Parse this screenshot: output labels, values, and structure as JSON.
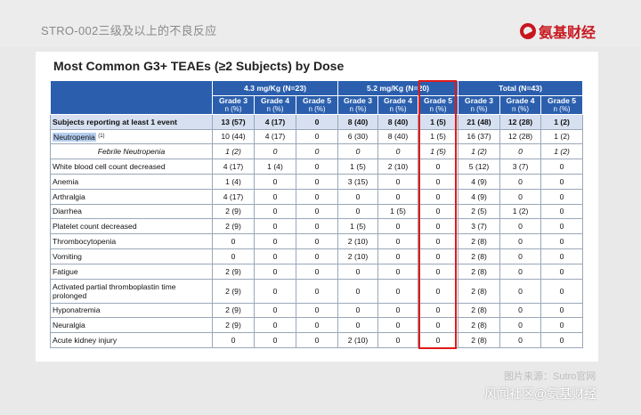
{
  "header": {
    "title": "STRO-002三级及以上的不良反应",
    "logo_text": "氨基财经"
  },
  "slide": {
    "title": "Most Common G3+ TEAEs (≥2 Subjects) by Dose"
  },
  "table": {
    "dose_groups": [
      "4.3 mg/Kg (N=23)",
      "5.2 mg/Kg (N=20)",
      "Total (N=43)"
    ],
    "grade_labels": [
      "Grade 3",
      "Grade 4",
      "Grade 5"
    ],
    "unit_label": "n (%)",
    "rows": [
      {
        "label": "Subjects reporting at least 1 event",
        "values": [
          "13 (57)",
          "4 (17)",
          "0",
          "8 (40)",
          "8 (40)",
          "1 (5)",
          "21 (48)",
          "12 (28)",
          "1 (2)"
        ]
      },
      {
        "label": "Neutropenia",
        "note": "(1)",
        "values": [
          "10 (44)",
          "4 (17)",
          "0",
          "6 (30)",
          "8 (40)",
          "1 (5)",
          "16 (37)",
          "12 (28)",
          "1 (2)"
        ]
      },
      {
        "label": "Febrile Neutropenia",
        "values": [
          "1 (2)",
          "0",
          "0",
          "0",
          "0",
          "1 (5)",
          "1 (2)",
          "0",
          "1 (2)"
        ]
      },
      {
        "label": "White blood cell count decreased",
        "values": [
          "4 (17)",
          "1 (4)",
          "0",
          "1 (5)",
          "2 (10)",
          "0",
          "5 (12)",
          "3 (7)",
          "0"
        ]
      },
      {
        "label": "Anemia",
        "values": [
          "1 (4)",
          "0",
          "0",
          "3 (15)",
          "0",
          "0",
          "4 (9)",
          "0",
          "0"
        ]
      },
      {
        "label": "Arthralgia",
        "values": [
          "4 (17)",
          "0",
          "0",
          "0",
          "0",
          "0",
          "4 (9)",
          "0",
          "0"
        ]
      },
      {
        "label": "Diarrhea",
        "values": [
          "2 (9)",
          "0",
          "0",
          "0",
          "1 (5)",
          "0",
          "2 (5)",
          "1 (2)",
          "0"
        ]
      },
      {
        "label": "Platelet count decreased",
        "values": [
          "2 (9)",
          "0",
          "0",
          "1 (5)",
          "0",
          "0",
          "3 (7)",
          "0",
          "0"
        ]
      },
      {
        "label": "Thrombocytopenia",
        "values": [
          "0",
          "0",
          "0",
          "2 (10)",
          "0",
          "0",
          "2 (8)",
          "0",
          "0"
        ]
      },
      {
        "label": "Vomiting",
        "values": [
          "0",
          "0",
          "0",
          "2 (10)",
          "0",
          "0",
          "2 (8)",
          "0",
          "0"
        ]
      },
      {
        "label": "Fatigue",
        "values": [
          "2 (9)",
          "0",
          "0",
          "0",
          "0",
          "0",
          "2 (8)",
          "0",
          "0"
        ]
      },
      {
        "label": "Activated partial thromboplastin time prolonged",
        "values": [
          "2 (9)",
          "0",
          "0",
          "0",
          "0",
          "0",
          "2 (8)",
          "0",
          "0"
        ]
      },
      {
        "label": "Hyponatremia",
        "values": [
          "2 (9)",
          "0",
          "0",
          "0",
          "0",
          "0",
          "2 (8)",
          "0",
          "0"
        ]
      },
      {
        "label": "Neuralgia",
        "values": [
          "2 (9)",
          "0",
          "0",
          "0",
          "0",
          "0",
          "2 (8)",
          "0",
          "0"
        ]
      },
      {
        "label": "Acute kidney injury",
        "values": [
          "0",
          "0",
          "0",
          "2 (10)",
          "0",
          "0",
          "2 (8)",
          "0",
          "0"
        ]
      }
    ]
  },
  "footer": {
    "source_note": "图片来源：Sutro官网",
    "watermark": "风闻社区@氨基财经"
  },
  "colors": {
    "header_blue": "#2b5fae",
    "highlight_red": "#e21a1a",
    "brand_red": "#c8161d"
  }
}
